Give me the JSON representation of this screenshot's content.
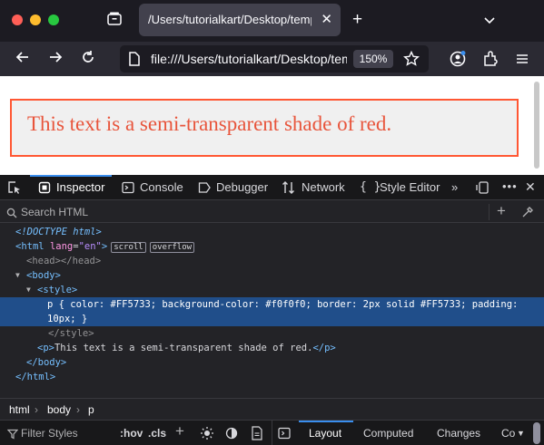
{
  "tab": {
    "title": "/Users/tutorialkart/Desktop/temp.html",
    "close_icon": "close-icon"
  },
  "toolbar": {
    "url": "file:///Users/tutorialkart/Desktop/temp.html",
    "zoom": "150%"
  },
  "page": {
    "paragraph_text": "This text is a semi-transparent shade of red."
  },
  "devtools": {
    "tabs": [
      "Inspector",
      "Console",
      "Debugger",
      "Network",
      "Style Editor"
    ],
    "search_placeholder": "Search HTML",
    "markup": {
      "doctype": "<!DOCTYPE html>",
      "html_open": "<html",
      "lang_attr": "lang",
      "lang_val": "\"en\"",
      "html_close_bracket": ">",
      "badge_scroll": "scroll",
      "badge_overflow": "overflow",
      "head": "<head></head>",
      "body_open": "<body>",
      "style_open": "<style>",
      "css_line1": "p { color: #FF5733; background-color: #f0f0f0; border: 2px solid #FF5733; padding:",
      "css_line2": "10px; }",
      "style_close": "</style>",
      "p_open": "<p>",
      "p_text": "This text is a semi-transparent shade of red.",
      "p_close": "</p>",
      "body_close": "</body>",
      "html_close": "</html>"
    },
    "breadcrumbs": [
      "html",
      "body",
      "p"
    ],
    "rules": {
      "filter_placeholder": "Filter Styles",
      "hov": ":hov",
      "cls": ".cls",
      "panels": [
        "Layout",
        "Computed",
        "Changes",
        "Co"
      ]
    }
  },
  "colors": {
    "accent": "#3a8eee",
    "demo_red": "#FF5733",
    "demo_bg": "#f0f0f0"
  }
}
